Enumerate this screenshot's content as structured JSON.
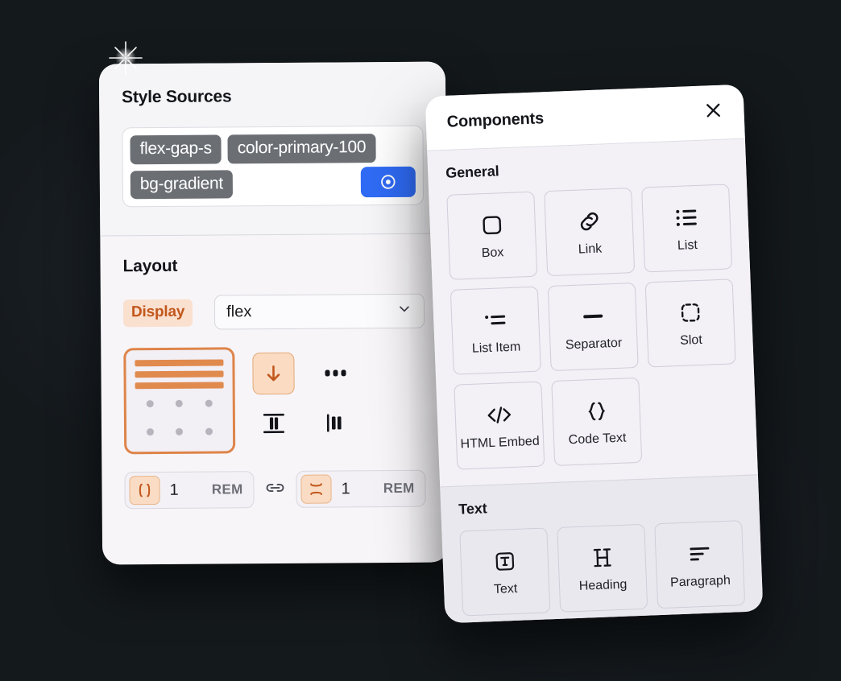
{
  "theme": {
    "background": "#14191c",
    "accent_orange": "#de8449",
    "accent_blue": "#2f6bf5",
    "chip_gray": "#6b6f74",
    "panel_light": "#f7f5f8",
    "panel_comp": "#eceaf1"
  },
  "style_panel": {
    "title": "Style Sources",
    "chips": [
      {
        "label": "flex-gap-s"
      },
      {
        "label": "color-primary-100"
      },
      {
        "label": "bg-gradient"
      }
    ],
    "eye_button_icon": "target-eye-icon",
    "layout": {
      "title": "Layout",
      "display_label": "Display",
      "display_value": "flex",
      "display_chevron_icon": "chevron-down-icon",
      "direction_preview_icon": "flex-column-preview-icon",
      "align_buttons": [
        {
          "icon": "arrow-down-icon",
          "active": true
        },
        {
          "icon": "dots-horizontal-icon",
          "active": false
        },
        {
          "icon": "align-center-vertical-icon",
          "active": false
        },
        {
          "icon": "align-start-horizontal-icon",
          "active": false
        }
      ],
      "gap_link_icon": "link-chain-icon",
      "gaps": [
        {
          "icon": "gap-horizontal-icon",
          "value": "1",
          "unit": "REM"
        },
        {
          "icon": "gap-vertical-icon",
          "value": "1",
          "unit": "REM"
        }
      ]
    }
  },
  "components_panel": {
    "title": "Components",
    "close_icon": "close-icon",
    "sections": [
      {
        "title": "General",
        "items": [
          {
            "label": "Box",
            "icon": "box-icon"
          },
          {
            "label": "Link",
            "icon": "link-icon"
          },
          {
            "label": "List",
            "icon": "list-icon"
          },
          {
            "label": "List Item",
            "icon": "list-item-icon"
          },
          {
            "label": "Separator",
            "icon": "separator-icon"
          },
          {
            "label": "Slot",
            "icon": "slot-dashed-icon"
          },
          {
            "label": "HTML Embed",
            "icon": "code-tag-icon"
          },
          {
            "label": "Code Text",
            "icon": "curly-braces-icon"
          }
        ]
      },
      {
        "title": "Text",
        "items": [
          {
            "label": "Text",
            "icon": "text-t-icon"
          },
          {
            "label": "Heading",
            "icon": "heading-h-icon"
          },
          {
            "label": "Paragraph",
            "icon": "paragraph-lines-icon"
          }
        ]
      }
    ]
  }
}
